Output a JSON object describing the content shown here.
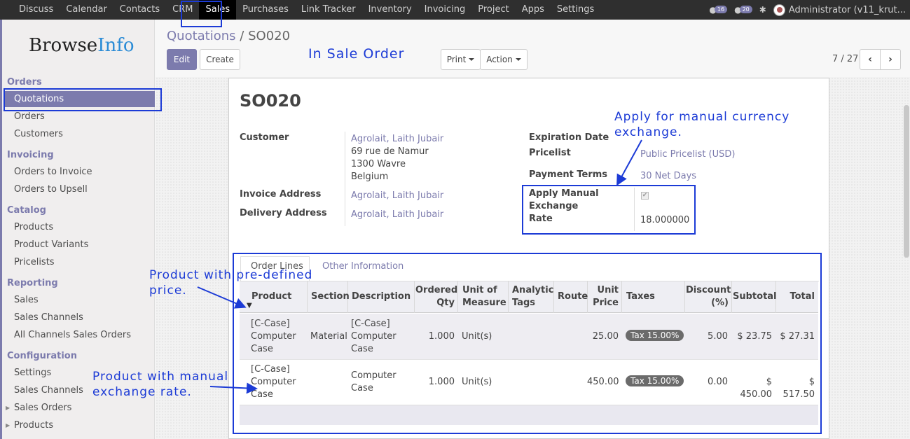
{
  "topbar": {
    "menu": [
      "Discuss",
      "Calendar",
      "Contacts",
      "CRM",
      "Sales",
      "Purchases",
      "Link Tracker",
      "Inventory",
      "Invoicing",
      "Project",
      "Apps",
      "Settings"
    ],
    "active": "Sales",
    "messages_count": "16",
    "chat_count": "20",
    "user": "Administrator (v11_krut..."
  },
  "sidebar": {
    "logo_a": "Browse",
    "logo_b": "Info",
    "sections": {
      "orders": "Orders",
      "invoicing": "Invoicing",
      "catalog": "Catalog",
      "reporting": "Reporting",
      "configuration": "Configuration"
    },
    "items": {
      "quotations": "Quotations",
      "orders": "Orders",
      "customers": "Customers",
      "orders_to_invoice": "Orders to Invoice",
      "orders_to_upsell": "Orders to Upsell",
      "products": "Products",
      "product_variants": "Product Variants",
      "pricelists": "Pricelists",
      "sales": "Sales",
      "sales_channels": "Sales Channels",
      "all_channels": "All Channels Sales Orders",
      "settings": "Settings",
      "cfg_sales_channels": "Sales Channels",
      "sales_orders": "Sales Orders",
      "cfg_products": "Products"
    }
  },
  "header": {
    "breadcrumb_parent": "Quotations",
    "breadcrumb_sep": "/",
    "breadcrumb_current": "SO020",
    "edit": "Edit",
    "create": "Create",
    "print": "Print",
    "action": "Action",
    "pager": "7 / 27"
  },
  "form": {
    "title": "SO020",
    "customer_label": "Customer",
    "customer_name": "Agrolait, Laith Jubair",
    "address_line1": "69 rue de Namur",
    "address_line2": "1300 Wavre",
    "address_line3": "Belgium",
    "invoice_label": "Invoice Address",
    "invoice_value": "Agrolait, Laith Jubair",
    "delivery_label": "Delivery Address",
    "delivery_value": "Agrolait, Laith Jubair",
    "expiration_label": "Expiration Date",
    "pricelist_label": "Pricelist",
    "pricelist_value": "Public Pricelist (USD)",
    "payment_label": "Payment Terms",
    "payment_value": "30 Net Days",
    "manual_label_1": "Apply Manual",
    "manual_label_2": "Exchange",
    "manual_label_3": "Rate",
    "manual_checked": true,
    "rate_value": "18.000000"
  },
  "tabs": {
    "order_lines": "Order Lines",
    "other_info": "Other Information"
  },
  "table": {
    "headers": {
      "product": "Product",
      "section": "Section",
      "description": "Description",
      "qty_1": "Ordered",
      "qty_2": "Qty",
      "uom_1": "Unit of",
      "uom_2": "Measure",
      "tags_1": "Analytic",
      "tags_2": "Tags",
      "route": "Route",
      "price_1": "Unit",
      "price_2": "Price",
      "taxes": "Taxes",
      "disc_1": "Discount",
      "disc_2": "(%)",
      "subtotal": "Subtotal",
      "total": "Total"
    },
    "rows": [
      {
        "product_1": "[C-Case]",
        "product_2": "Computer",
        "product_3": "Case",
        "section": "Material",
        "desc_1": "[C-Case]",
        "desc_2": "Computer",
        "desc_3": "Case",
        "qty": "1.000",
        "uom": "Unit(s)",
        "price": "25.00",
        "tax": "Tax 15.00%",
        "discount": "5.00",
        "subtotal": "$ 23.75",
        "total": "$ 27.31"
      },
      {
        "product_1": "[C-Case]",
        "product_2": "Computer",
        "product_3": "Case",
        "section": "",
        "desc_1": "Computer",
        "desc_2": "Case",
        "qty": "1.000",
        "uom": "Unit(s)",
        "price": "450.00",
        "tax": "Tax 15.00%",
        "discount": "0.00",
        "subtotal": "$ 450.00",
        "total": "$ 517.50"
      }
    ]
  },
  "annotations": {
    "in_sale_order": "In Sale Order",
    "manual_1": "Apply for manual currency",
    "manual_2": "exchange.",
    "predefined_1": "Product with pre-defined",
    "predefined_2": "price.",
    "manual_rate_1": "Product with manual",
    "manual_rate_2": "exchange rate."
  },
  "colors": {
    "brand": "#7c7bad",
    "annotation": "#1c3bd6",
    "topbar": "#2f2f2f"
  }
}
